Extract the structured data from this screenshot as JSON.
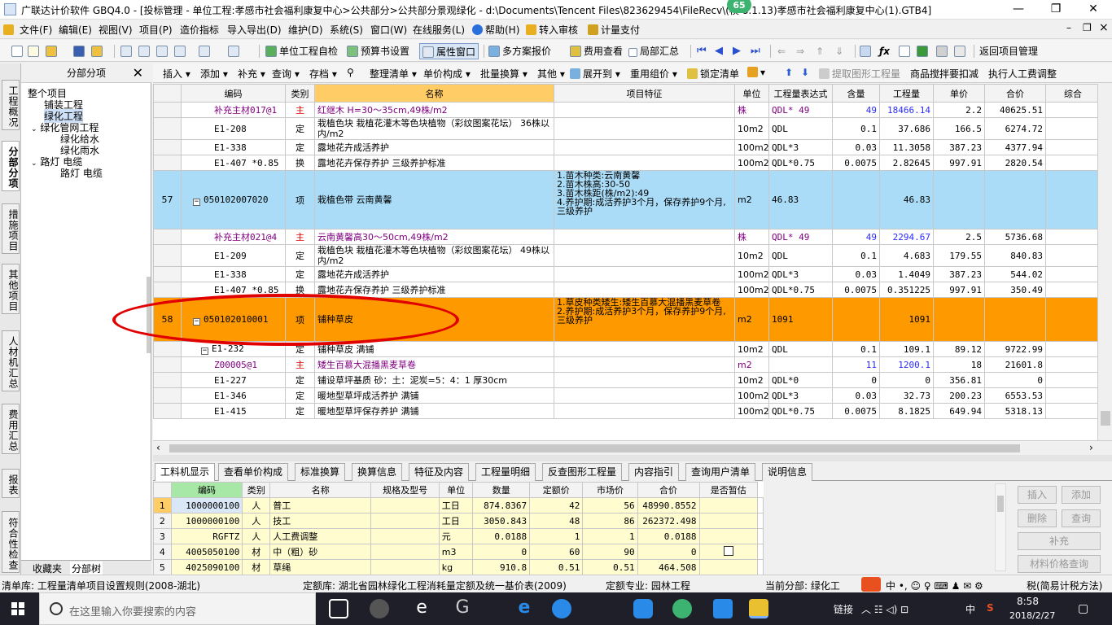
{
  "window": {
    "title": "广联达计价软件 GBQ4.0 - [投标管理 - 单位工程:孝感市社会福利康复中心>公共部分>公共部分景观绿化 - d:\\Documents\\Tencent Files\\823629454\\FileRecv\\(模                8.1.13)孝感市社会福利康复中心(1).GTB4]",
    "badge": "65",
    "controls": {
      "minimize": "—",
      "restore": "❐",
      "close": "✕"
    },
    "mdi": {
      "minimize": "–",
      "restore": "❐",
      "close": "×"
    }
  },
  "menubar": [
    "文件(F)",
    "编辑(E)",
    "视图(V)",
    "项目(P)",
    "造价指标",
    "导入导出(D)",
    "维护(D)",
    "系统(S)",
    "窗口(W)",
    "在线服务(L)",
    "帮助(H)",
    "转入审核",
    "计量支付"
  ],
  "toolbar1": [
    "单位工程自检",
    "预算书设置",
    "属性窗口",
    "多方案报价",
    "费用查看",
    "局部汇总",
    "返回项目管理"
  ],
  "vtabs": [
    "工程概况",
    "分部分项",
    "措施项目",
    "其他项目",
    "人材机汇总",
    "费用汇总",
    "报表",
    "符合性检查"
  ],
  "left_panel": {
    "header": "分部分项",
    "close": "✕",
    "tree": [
      "整个项目",
      "铺装工程",
      "绿化工程",
      "绿化管网工程",
      "绿化给水",
      "绿化雨水",
      "路灯 电缆",
      "路灯 电缆"
    ],
    "bottom_tabs": [
      "收藏夹",
      "分部树"
    ]
  },
  "toolbar2": [
    "插入",
    "添加",
    "补充",
    "查询",
    "存档",
    "整理清单",
    "单价构成",
    "批量换算",
    "其他",
    "展开到",
    "重用组价",
    "锁定清单",
    "提取图形工程量",
    "商品搅拌要扣减",
    "执行人工费调整"
  ],
  "grid": {
    "headers": [
      "编码",
      "类别",
      "名称",
      "项目特征",
      "单位",
      "工程量表达式",
      "含量",
      "工程量",
      "单价",
      "合价",
      "综合"
    ],
    "rows": [
      {
        "type": "child",
        "no": "",
        "code": "补充主材017@1",
        "cat": "主",
        "name": "红继木 H=30～35cm,49株/m2",
        "feat": "",
        "unit": "株",
        "expr": "QDL* 49",
        "qty": "49",
        "amount": "18466.14",
        "price": "2.2",
        "total": "40625.51",
        "style": "material"
      },
      {
        "type": "child",
        "no": "",
        "code": "E1-208",
        "cat": "定",
        "name": "栽植色块 栽植花灌木等色块植物（彩纹图案花坛） 36株以内/m2",
        "feat": "",
        "unit": "10m2",
        "expr": "QDL",
        "qty": "0.1",
        "amount": "37.686",
        "price": "166.5",
        "total": "6274.72",
        "style": ""
      },
      {
        "type": "child",
        "no": "",
        "code": "E1-338",
        "cat": "定",
        "name": "露地花卉成活养护",
        "feat": "",
        "unit": "100m2",
        "expr": "QDL*3",
        "qty": "0.03",
        "amount": "11.3058",
        "price": "387.23",
        "total": "4377.94",
        "style": ""
      },
      {
        "type": "child",
        "no": "",
        "code": "E1-407 *0.85",
        "cat": "换",
        "name": "露地花卉保存养护 三级养护标准",
        "feat": "",
        "unit": "100m2",
        "expr": "QDL*0.75",
        "qty": "0.0075",
        "amount": "2.82645",
        "price": "997.91",
        "total": "2820.54",
        "style": ""
      },
      {
        "type": "blue",
        "no": "57",
        "code": "050102007020",
        "cat": "项",
        "name": "栽植色带 云南黄馨",
        "feat": "1.苗木种类:云南黄馨\n2.苗木株高:30-50\n3.苗木株距(株/m2):49\n4.养护期:成活养护3个月，保存养护9个月,三级养护",
        "unit": "m2",
        "expr": "46.83",
        "qty": "",
        "amount": "46.83",
        "price": "",
        "total": "",
        "style": ""
      },
      {
        "type": "child",
        "no": "",
        "code": "补充主材021@4",
        "cat": "主",
        "name": "云南黄馨高30～50cm,49株/m2",
        "feat": "",
        "unit": "株",
        "expr": "QDL* 49",
        "qty": "49",
        "amount": "2294.67",
        "price": "2.5",
        "total": "5736.68",
        "style": "material"
      },
      {
        "type": "child",
        "no": "",
        "code": "E1-209",
        "cat": "定",
        "name": "栽植色块 栽植花灌木等色块植物（彩纹图案花坛） 49株以内/m2",
        "feat": "",
        "unit": "10m2",
        "expr": "QDL",
        "qty": "0.1",
        "amount": "4.683",
        "price": "179.55",
        "total": "840.83",
        "style": ""
      },
      {
        "type": "child",
        "no": "",
        "code": "E1-338",
        "cat": "定",
        "name": "露地花卉成活养护",
        "feat": "",
        "unit": "100m2",
        "expr": "QDL*3",
        "qty": "0.03",
        "amount": "1.4049",
        "price": "387.23",
        "total": "544.02",
        "style": ""
      },
      {
        "type": "child",
        "no": "",
        "code": "E1-407 *0.85",
        "cat": "换",
        "name": "露地花卉保存养护 三级养护标准",
        "feat": "",
        "unit": "100m2",
        "expr": "QDL*0.75",
        "qty": "0.0075",
        "amount": "0.351225",
        "price": "997.91",
        "total": "350.49",
        "style": ""
      },
      {
        "type": "orange",
        "no": "58",
        "code": "050102010001",
        "cat": "项",
        "name": "铺种草皮",
        "feat": "1.草皮种类矮生:矮生百慕大混播黑麦草卷\n2.养护期:成活养护3个月，保存养护9个月,三级养护",
        "unit": "m2",
        "expr": "1091",
        "qty": "",
        "amount": "1091",
        "price": "",
        "total": "",
        "style": ""
      },
      {
        "type": "child",
        "no": "",
        "code": "E1-232",
        "cat": "定",
        "name": "铺种草皮 满铺",
        "feat": "",
        "unit": "10m2",
        "expr": "QDL",
        "qty": "0.1",
        "amount": "109.1",
        "price": "89.12",
        "total": "9722.99",
        "style": "expand"
      },
      {
        "type": "child",
        "no": "",
        "code": "Z00005@1",
        "cat": "主",
        "name": "矮生百慕大混播黑麦草卷",
        "feat": "",
        "unit": "m2",
        "expr": "",
        "qty": "11",
        "amount": "1200.1",
        "price": "18",
        "total": "21601.8",
        "style": "material"
      },
      {
        "type": "child",
        "no": "",
        "code": "E1-227",
        "cat": "定",
        "name": "铺设草坪基质 砂：土：泥炭=5：4：1 厚30cm",
        "feat": "",
        "unit": "10m2",
        "expr": "QDL*0",
        "qty": "0",
        "amount": "0",
        "price": "356.81",
        "total": "0",
        "style": ""
      },
      {
        "type": "child",
        "no": "",
        "code": "E1-346",
        "cat": "定",
        "name": "暖地型草坪成活养护 满铺",
        "feat": "",
        "unit": "100m2",
        "expr": "QDL*3",
        "qty": "0.03",
        "amount": "32.73",
        "price": "200.23",
        "total": "6553.53",
        "style": ""
      },
      {
        "type": "child",
        "no": "",
        "code": "E1-415",
        "cat": "定",
        "name": "暖地型草坪保存养护 满铺",
        "feat": "",
        "unit": "100m2",
        "expr": "QDL*0.75",
        "qty": "0.0075",
        "amount": "8.1825",
        "price": "649.94",
        "total": "5318.13",
        "style": ""
      }
    ]
  },
  "lower_tabs": [
    "工料机显示",
    "查看单价构成",
    "标准换算",
    "换算信息",
    "特征及内容",
    "工程量明细",
    "反查图形工程量",
    "内容指引",
    "查询用户清单",
    "说明信息"
  ],
  "lower_grid": {
    "headers": [
      "编码",
      "类别",
      "名称",
      "规格及型号",
      "单位",
      "数量",
      "定额价",
      "市场价",
      "合价",
      "是否暂估"
    ],
    "rows": [
      {
        "no": "1",
        "code": "1000000100",
        "cat": "人",
        "name": "普工",
        "spec": "",
        "unit": "工日",
        "qty": "874.8367",
        "quota": "42",
        "market": "56",
        "total": "48990.8552",
        "est": false
      },
      {
        "no": "2",
        "code": "1000000100",
        "cat": "人",
        "name": "技工",
        "spec": "",
        "unit": "工日",
        "qty": "3050.843",
        "quota": "48",
        "market": "86",
        "total": "262372.498",
        "est": false
      },
      {
        "no": "3",
        "code": "RGFTZ",
        "cat": "人",
        "name": "人工费调整",
        "spec": "",
        "unit": "元",
        "qty": "0.0188",
        "quota": "1",
        "market": "1",
        "total": "0.0188",
        "est": false
      },
      {
        "no": "4",
        "code": "4005050100",
        "cat": "材",
        "name": "中（粗）砂",
        "spec": "",
        "unit": "m3",
        "qty": "0",
        "quota": "60",
        "market": "90",
        "total": "0",
        "est": true
      },
      {
        "no": "5",
        "code": "4025090100",
        "cat": "材",
        "name": "草绳",
        "spec": "",
        "unit": "kg",
        "qty": "910.8",
        "quota": "0.51",
        "market": "0.51",
        "total": "464.508",
        "est": false
      }
    ]
  },
  "side_buttons": [
    "插入",
    "添加",
    "删除",
    "查询",
    "补充",
    "材料价格查询"
  ],
  "statusbar": {
    "list_lib": "清单库:  工程量清单项目设置规则(2008-湖北)",
    "quota_lib": "定额库:  湖北省园林绿化工程消耗量定额及统一基价表(2009)",
    "quota_major": "定额专业:  园林工程",
    "current": "当前分部:  绿化工",
    "tax": "税(简易计税方法)"
  },
  "taskbar": {
    "search_placeholder": "在这里输入你要搜索的内容",
    "tray_link": "链接",
    "ime": "中",
    "time": "8:58",
    "date": "2018/2/27",
    "ime2": "中"
  }
}
